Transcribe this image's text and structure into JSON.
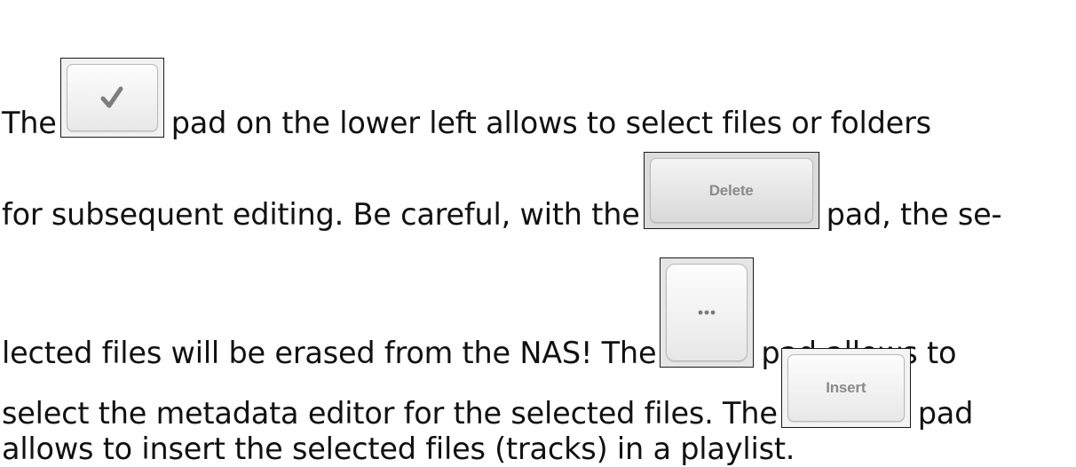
{
  "lines": {
    "l1": {
      "before": "The",
      "after": "pad on the lower left allows to select files or folders"
    },
    "l2": {
      "before": "for subsequent editing. Be careful, with the",
      "after": "pad, the se-"
    },
    "l3": {
      "before": "lected files will be erased from the NAS! The",
      "after": "pad allows to"
    },
    "l4": {
      "before": "select the metadata editor for the selected files. The",
      "after": "pad"
    },
    "l5": {
      "text": "allows to insert the selected files (tracks) in a playlist."
    }
  },
  "pads": {
    "select": {
      "icon": "checkmark-icon"
    },
    "delete": {
      "label": "Delete"
    },
    "more": {
      "icon": "more-dots-icon"
    },
    "insert": {
      "label": "Insert"
    }
  }
}
